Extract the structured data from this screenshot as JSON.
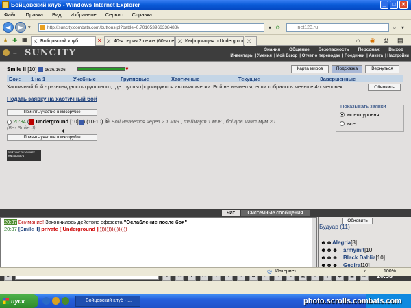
{
  "window": {
    "title": "Бойцовский клуб - Windows Internet Explorer",
    "min": "_",
    "max": "□",
    "close": "✕"
  },
  "menu": [
    "Файл",
    "Правка",
    "Вид",
    "Избранное",
    "Сервис",
    "Справка"
  ],
  "address": {
    "url": "http://suncity.combats.com/buttons.pl?battle=0.701053966338488#",
    "search": "inet123.ru"
  },
  "tabs": [
    "Бойцовский клуб",
    "40-я серия 2 сезон (60-я се...",
    "Информация о Underground"
  ],
  "game": {
    "logo": "SUNCITY",
    "nav_top": [
      "Знания",
      "Общение",
      "Безопасность",
      "Персонаж",
      "Выход"
    ],
    "nav_bottom": [
      "Инвентарь",
      "Умения",
      "Мой Ecrop",
      "Отчет о переводах",
      "Поединки",
      "Анкета",
      "Настройки"
    ],
    "player": {
      "name": "Smile II",
      "level": "[10]",
      "hp": "1636/1636"
    },
    "buttons": {
      "map": "Карта миров",
      "help": "Подсказка",
      "back": "Вернуться",
      "refresh": "Обновить"
    },
    "battle_label": "Бои:",
    "battle_tabs": [
      "1 на 1",
      "Учебные",
      "Групповые",
      "Хаотичные",
      "Текущие",
      "Завершенные"
    ],
    "description": "Хаотичный бой - разновидность группового, где группы формируются автоматически. Бой не начнется, если собралось меньше 4-х человек.",
    "submit_link": "Подать заявку на хаотичный бой",
    "join_button": "Принять участие в мясорубке",
    "show_label": "Показывать заявки",
    "show_options": [
      "моего уровня",
      "все"
    ],
    "request": {
      "time": "20:34",
      "name": "Underground",
      "level": "[10]",
      "range": "(10-10)",
      "status": "Бой начнется через 2.1 мин., таймаут 1 мин., бойцов максимум 20"
    },
    "no_player": "(Без Smile II)",
    "counter": "РЕЙТИНГ 31264097K  mail.ru  25871"
  },
  "chat": {
    "tabs": [
      "Чат",
      "Системные сообщения"
    ],
    "lines": [
      {
        "time": "20:37",
        "label": "Внимание!",
        "text": " Закончилось действие эффекта ",
        "effect": "\"Ослабление после боя\""
      },
      {
        "time": "20:37",
        "who": "[Smile II]",
        "priv": "private [ Underground ]",
        "msg": " ))))))))))))))))"
      }
    ]
  },
  "online": {
    "refresh": "Обновить",
    "room": "Будуар (11)",
    "users": [
      {
        "name": "Alegria",
        "lvl": "[8]"
      },
      {
        "name": "armymit",
        "lvl": "[10]"
      },
      {
        "name": "Black Dahlia",
        "lvl": "[10]"
      },
      {
        "name": "Gegira",
        "lvl": "[10]"
      }
    ]
  },
  "clock": "20:38",
  "status": {
    "zone": "Интернет",
    "zoom": "100%"
  },
  "taskbar": {
    "start": "пуск",
    "item": "Бойцовский клуб - ..."
  },
  "watermark": "photo.scrolls.combats.com"
}
